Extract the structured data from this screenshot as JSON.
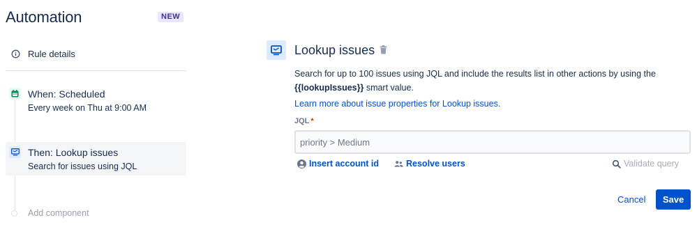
{
  "sidebar": {
    "title": "Automation",
    "badge": "NEW",
    "rule_details": {
      "label": "Rule details",
      "icon": "info-icon"
    },
    "steps": [
      {
        "title": "When: Scheduled",
        "subtitle": "Every week on Thu at 9:00 AM",
        "icon": "calendar-icon",
        "active": false
      },
      {
        "title": "Then: Lookup issues",
        "subtitle": "Search for issues using JQL",
        "icon": "monitor-icon",
        "active": true
      }
    ],
    "add_component": "Add component"
  },
  "panel": {
    "title": "Lookup issues",
    "description_prefix": "Search for up to 100 issues using JQL and include the results list in other actions by using the",
    "description_bold": "{{lookupIssues}}",
    "description_suffix": " smart value.",
    "learn_more": "Learn more about issue properties for Lookup issues.",
    "jql": {
      "label": "JQL",
      "required_marker": "*",
      "value": "priority > Medium"
    },
    "links": {
      "insert_account": "Insert account id",
      "resolve_users": "Resolve users",
      "validate_query": "Validate query"
    },
    "actions": {
      "cancel": "Cancel",
      "save": "Save"
    }
  },
  "colors": {
    "primary": "#0052cc",
    "text": "#172b4d",
    "muted": "#6b778c",
    "badge_bg": "#eae6ff",
    "badge_text": "#403294",
    "required": "#de350b"
  }
}
